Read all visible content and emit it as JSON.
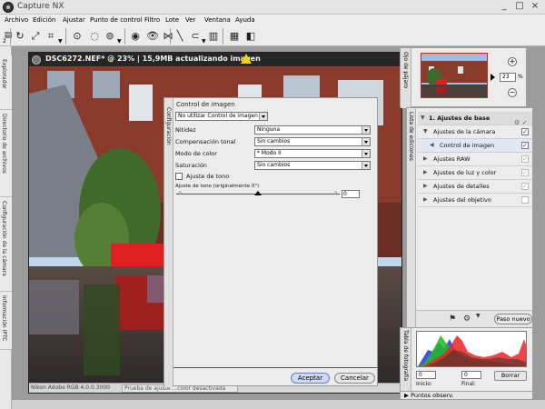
{
  "window": {
    "title": "Capture NX"
  },
  "menu": [
    "Archivo",
    "Edición",
    "Ajustar",
    "Punto de control",
    "Filtro",
    "Lote",
    "Ver",
    "Ventana",
    "Ayuda"
  ],
  "toolbar": {
    "layout_number": "2"
  },
  "left_dock": {
    "tabs": [
      "Explorador",
      "Directorio de archivos",
      "Configuración de la cámara",
      "Información IPTC"
    ]
  },
  "image_window": {
    "title": "DSC6272.NEF* @ 23% | 15,9MB actualizando imagen",
    "status_left": "Nikon Adobe RGB 4.0.0.3000",
    "status_mid": "Prueba de ajuste....color desactivada"
  },
  "dialog": {
    "side_tab": "Configuración",
    "title": "Control de imagen",
    "preset": "No utilizar Control de imagen",
    "rows": [
      {
        "label": "Nitidez",
        "value": "Ninguna"
      },
      {
        "label": "Compensación tonal",
        "value": "Sin cambios"
      },
      {
        "label": "Modo de color",
        "value": "* Modo II"
      },
      {
        "label": "Saturación",
        "value": "Sin cambios"
      }
    ],
    "tone_checkbox": "Ajuste de tono",
    "tone_slider_label": "Ajuste de tono (originalmente 0°)",
    "tone_slider_min": "-9",
    "tone_slider_max": "9",
    "tone_value": "0",
    "tone_level": 0,
    "accept": "Aceptar",
    "cancel": "Cancelar"
  },
  "navigator": {
    "side_tab": "Ojo de pájaro",
    "zoom_value": "23",
    "zoom_unit": "%",
    "zoom_in": "+",
    "zoom_out": "−"
  },
  "edit_list": {
    "side_tab": "Lista de ediciones",
    "steps": [
      {
        "label": "1. Ajustes de base",
        "kind": "header",
        "check": ""
      },
      {
        "label": "Ajustes de la cámara",
        "kind": "expanded",
        "check": "✓"
      },
      {
        "label": "Control de imagen",
        "kind": "selected",
        "check": "✓"
      },
      {
        "label": "Ajustes RAW",
        "kind": "collapsed",
        "check": "✓"
      },
      {
        "label": "Ajustes de luz y color",
        "kind": "collapsed",
        "check": "✓"
      },
      {
        "label": "Ajustes de detalles",
        "kind": "collapsed",
        "check": "✓"
      },
      {
        "label": "Ajustes del objetivo",
        "kind": "collapsed",
        "check": ""
      }
    ],
    "new_step_button": "Paso nuevo"
  },
  "histogram": {
    "side_tab": "Tabla de fotografía",
    "input_label": "Inicio:",
    "final_label": "Final:",
    "input_value": "0",
    "final_value": "0",
    "clear_button": "Borrar"
  },
  "points_panel": {
    "label": "Puntos observ."
  },
  "colors": {
    "accent_blue": "#2b35a8",
    "warning_yellow": "#f5d300",
    "thumb_border": "#cc2222"
  }
}
